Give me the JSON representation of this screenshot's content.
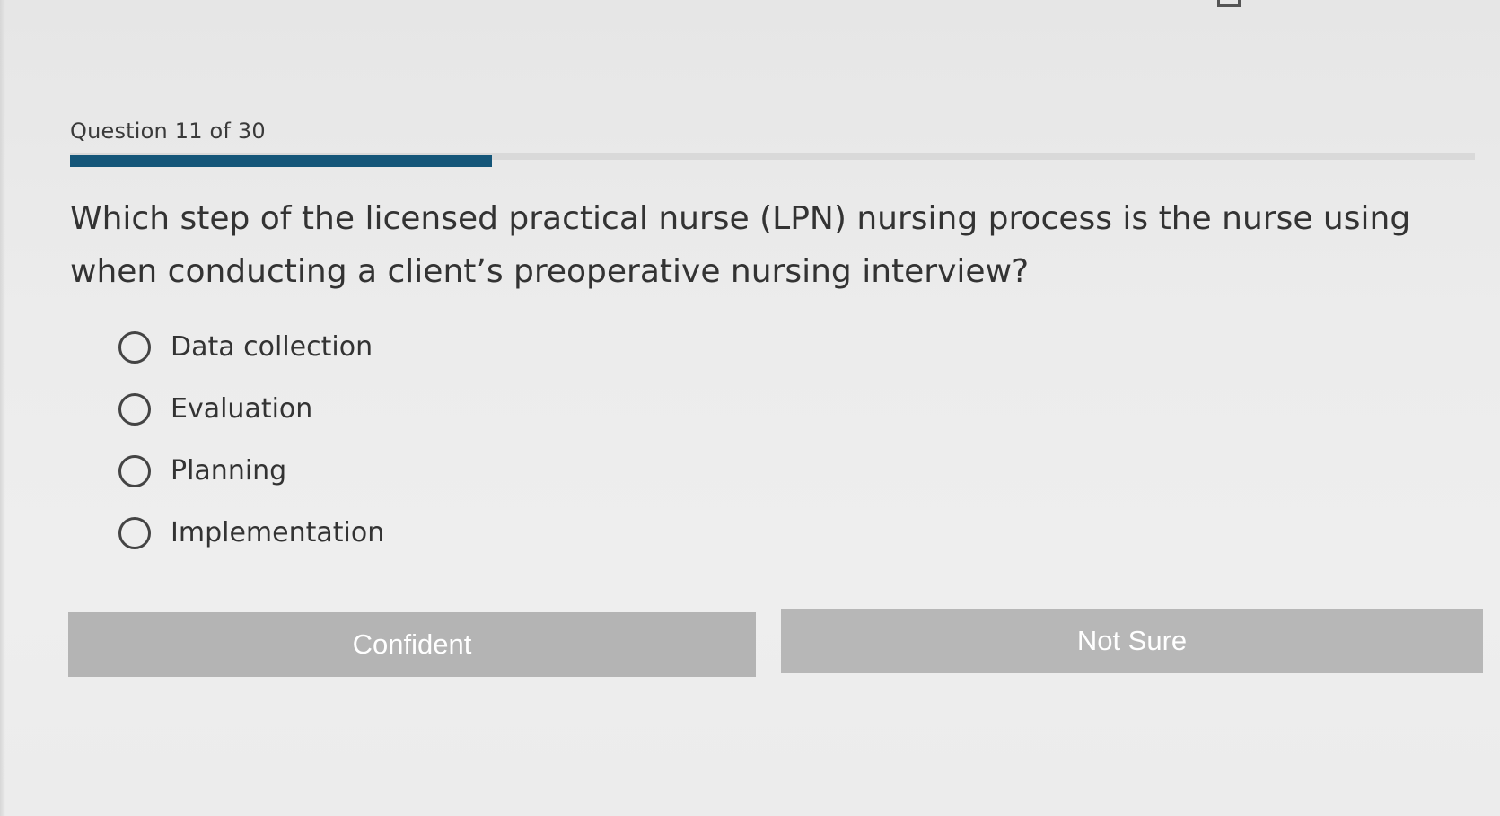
{
  "header": {
    "question_counter": "Question 11 of 30",
    "progress": {
      "current": 11,
      "total": 30,
      "fraction": 0.3
    }
  },
  "question": {
    "text": "Which step of the licensed practical nurse (LPN) nursing process is the nurse using when conducting a client’s preoperative nursing interview?"
  },
  "options": [
    {
      "label": "Data collection",
      "selected": false
    },
    {
      "label": "Evaluation",
      "selected": false
    },
    {
      "label": "Planning",
      "selected": false
    },
    {
      "label": "Implementation",
      "selected": false
    }
  ],
  "actions": {
    "confident_label": "Confident",
    "not_sure_label": "Not Sure"
  },
  "colors": {
    "progress_fill": "#155679",
    "progress_track": "#d9d9d9",
    "button_bg": "#b4b4b4",
    "button_text": "#ffffff",
    "page_bg": "#e9e9e9"
  },
  "icons": {
    "corner": "toolbar-icon"
  }
}
